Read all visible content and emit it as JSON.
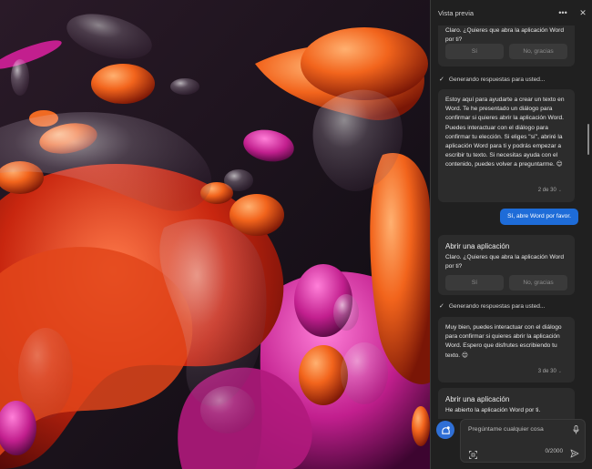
{
  "panel": {
    "title": "Vista previa",
    "more_icon": "more-horizontal-icon",
    "close_icon": "close-icon"
  },
  "chat": {
    "card1": {
      "text": "Claro. ¿Quieres que abra la aplicación Word por ti?",
      "yes_label": "Sí",
      "no_label": "No, gracias"
    },
    "status1": "Generando respuestas para usted...",
    "card2": {
      "text": "Estoy aquí para ayudarte a crear un texto en Word. Te he presentado un diálogo para confirmar si quieres abrir la aplicación Word. Puedes interactuar con el diálogo para confirmar tu elección. Si eliges \"sí\", abriré la aplicación Word para ti y podrás empezar a escribir tu texto. Si necesitas ayuda con el contenido, puedes volver a preguntarme. 😊",
      "pager": "2 de 30"
    },
    "user_message": "Sí, abre Word por favor.",
    "card3": {
      "title": "Abrir una aplicación",
      "text": "Claro. ¿Quieres que abra la aplicación Word por ti?",
      "yes_label": "Sí",
      "no_label": "No, gracias"
    },
    "status2": "Generando respuestas para usted...",
    "card4": {
      "text": "Muy bien, puedes interactuar con el diálogo para confirmar si quieres abrir la aplicación Word. Espero que disfrutes escribiendo tu texto. 😊",
      "pager": "3 de 30"
    },
    "card5": {
      "title": "Abrir una aplicación",
      "text": "He abierto la aplicación Word por ti."
    }
  },
  "composer": {
    "placeholder": "Pregúntame cualquier cosa",
    "counter": "0/2000"
  },
  "colors": {
    "accent": "#1e6cd8",
    "panel_bg": "#202020",
    "card_bg": "#2c2c2c"
  }
}
